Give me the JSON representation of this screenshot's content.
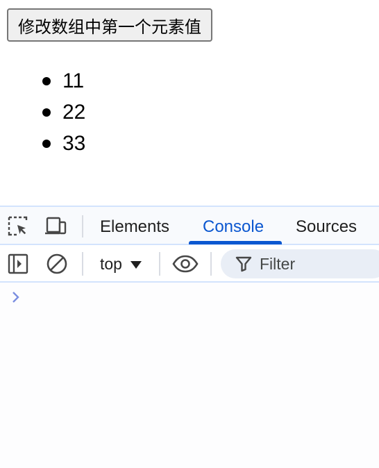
{
  "page": {
    "button_label": "修改数组中第一个元素值",
    "list_items": [
      "11",
      "22",
      "33"
    ]
  },
  "devtools": {
    "tabs": [
      {
        "label": "Elements",
        "active": false
      },
      {
        "label": "Console",
        "active": true
      },
      {
        "label": "Sources",
        "active": false
      }
    ],
    "toolbar": {
      "context": "top",
      "filter_placeholder": "Filter"
    },
    "icons": [
      "inspect-element-icon",
      "device-toolbar-icon",
      "sidebar-toggle-icon",
      "clear-console-icon",
      "eye-icon",
      "filter-icon",
      "prompt-chevron-icon"
    ],
    "colors": {
      "accent": "#0b57d0",
      "border": "#d3e3fd",
      "icon": "#474747",
      "prompt": "#7b8ee0"
    }
  }
}
